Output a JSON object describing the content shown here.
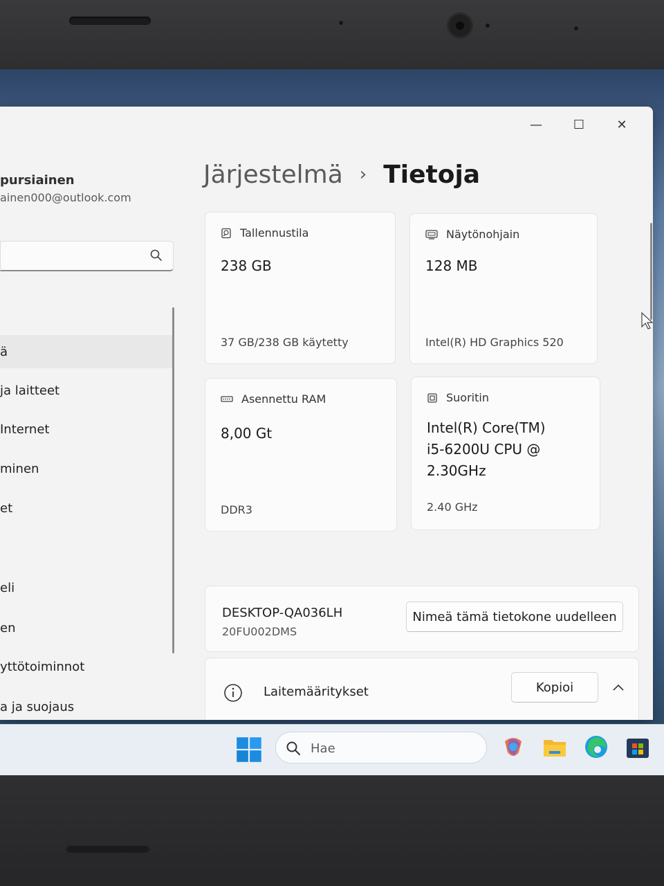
{
  "window": {
    "controls": {
      "minimize": "—",
      "maximize": "☐",
      "close": "✕"
    }
  },
  "sidebar": {
    "user_name": "pursiainen",
    "user_email": "ainen000@outlook.com",
    "search_placeholder": "",
    "items": [
      {
        "label": "ä",
        "selected": true
      },
      {
        "label": " ja laitteet"
      },
      {
        "label": "Internet"
      },
      {
        "label": "minen"
      },
      {
        "label": "et"
      },
      {
        "label": "eli"
      },
      {
        "label": "en"
      },
      {
        "label": "yttötoiminnot"
      },
      {
        "label": "a ja suojaus"
      }
    ]
  },
  "breadcrumb": {
    "parent": "Järjestelmä",
    "separator": "›",
    "current": "Tietoja"
  },
  "cards": {
    "storage": {
      "title": "Tallennustila",
      "value": "238 GB",
      "sub": "37 GB/238 GB käytetty",
      "icon": "storage-icon"
    },
    "gpu": {
      "title": "Näytönohjain",
      "value": "128 MB",
      "sub": "Intel(R) HD Graphics 520",
      "icon": "display-adapter-icon"
    },
    "ram": {
      "title": "Asennettu RAM",
      "value": "8,00 Gt",
      "sub": "DDR3",
      "icon": "memory-icon"
    },
    "cpu": {
      "title": "Suoritin",
      "value_lines": [
        "Intel(R) Core(TM)",
        "i5-6200U CPU @",
        "2.30GHz"
      ],
      "sub": "2.40 GHz",
      "icon": "processor-icon"
    }
  },
  "device": {
    "name": "DESKTOP-QA036LH",
    "model": "20FU002DMS",
    "rename_button": "Nimeä tämä tietokone uudelleen"
  },
  "specs": {
    "title": "Laitemääritykset",
    "copy_button": "Kopioi",
    "icon": "info-icon",
    "expand_icon": "chevron-up-icon"
  },
  "taskbar": {
    "search_label": "Hae",
    "apps": [
      "start-icon",
      "copilot-icon",
      "file-explorer-icon",
      "edge-icon",
      "store-icon"
    ]
  }
}
